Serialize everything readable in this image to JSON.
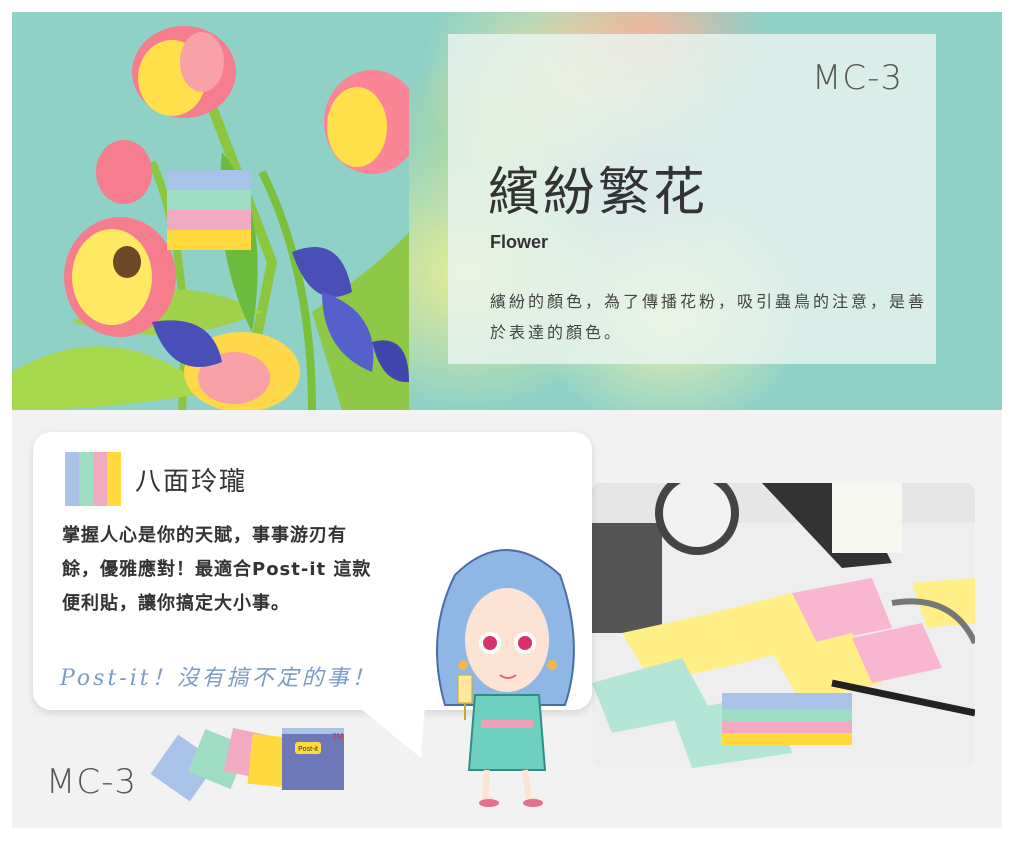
{
  "top_banner": {
    "code": "MC-3",
    "title": "繽紛繁花",
    "subtitle": "Flower",
    "description": "繽紛的顏色，為了傳播花粉，吸引蟲鳥的注意，是善於表達的顏色。"
  },
  "bubble": {
    "heading": "八面玲瓏",
    "body_lines": [
      "掌握人心是你的天賦，事事游刃有",
      "餘，優雅應對！最適合Post-it 這款",
      "便利貼，讓你搞定大小事。"
    ],
    "slogan": "Post-it！沒有搞不定的事！"
  },
  "product": {
    "code": "MC-3",
    "pack_brand": "Post-it",
    "pack_logo": "3M"
  },
  "palette": {
    "blue": "#a9c3e8",
    "green": "#9fdcc4",
    "pink": "#f2a9c2",
    "yellow": "#ffd93d",
    "teal_bg": "#8fd1c7"
  }
}
